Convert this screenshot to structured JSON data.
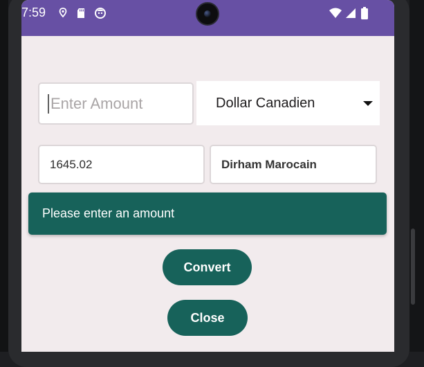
{
  "status_bar": {
    "time": "7:59",
    "left_icons": [
      "location-pin-icon",
      "sd-card-icon",
      "app-face-icon"
    ],
    "right_icons": [
      "wifi-icon",
      "signal-icon",
      "battery-icon"
    ],
    "color": "#6750a4"
  },
  "form": {
    "amount_placeholder": "Enter Amount",
    "source_currency": "Dollar Canadien",
    "result_value": "1645.02",
    "target_currency": "Dirham Marocain"
  },
  "snackbar": {
    "message": "Please enter an amount"
  },
  "buttons": {
    "convert_label": "Convert",
    "close_label": "Close"
  },
  "colors": {
    "accent": "#17625a",
    "background": "#f2ebed"
  }
}
